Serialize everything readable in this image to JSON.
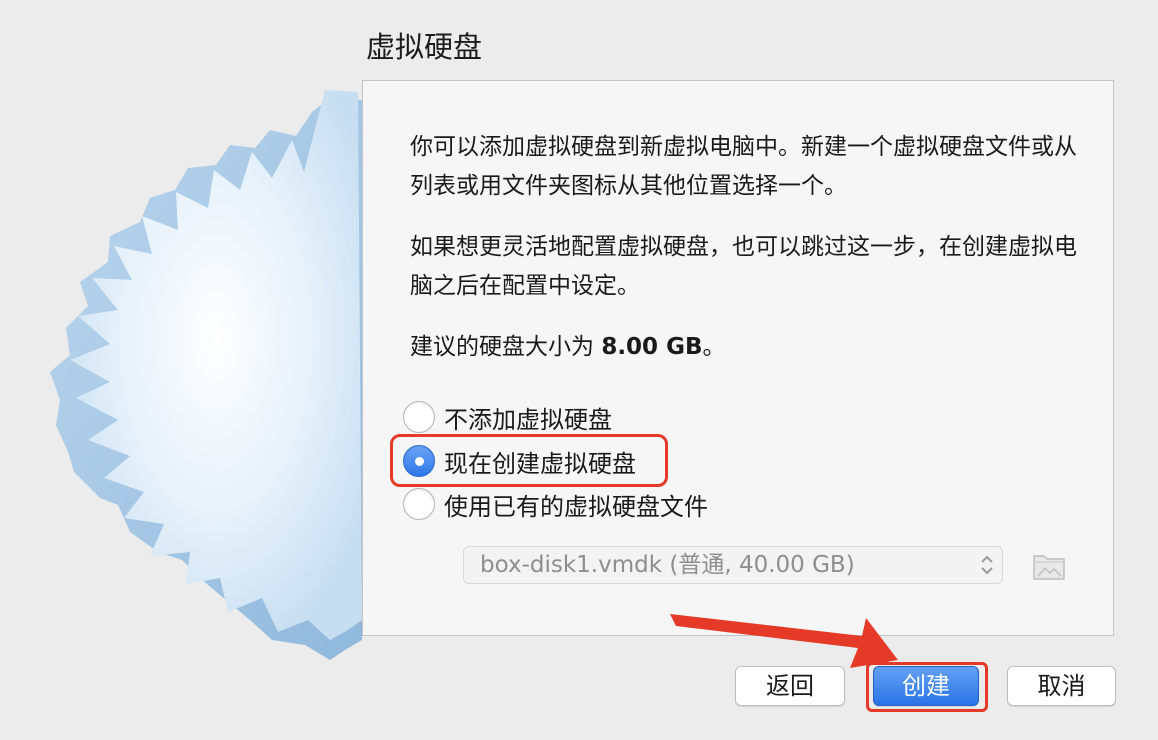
{
  "dialog": {
    "title": "虚拟硬盘"
  },
  "description": {
    "paragraph1": "你可以添加虚拟硬盘到新虚拟电脑中。新建一个虚拟硬盘文件或从列表或用文件夹图标从其他位置选择一个。",
    "paragraph2": "如果想更灵活地配置虚拟硬盘，也可以跳过这一步，在创建虚拟电脑之后在配置中设定。",
    "recommend_prefix": "建议的硬盘大小为 ",
    "recommend_size": "8.00 GB",
    "recommend_suffix": "。"
  },
  "options": {
    "no_disk": {
      "label": "不添加虚拟硬盘",
      "checked": false
    },
    "create_now": {
      "label": "现在创建虚拟硬盘",
      "checked": true
    },
    "use_existing": {
      "label": "使用已有的虚拟硬盘文件",
      "checked": false
    }
  },
  "disk_select": {
    "value": "box-disk1.vmdk (普通, 40.00 GB)",
    "enabled": false
  },
  "buttons": {
    "back": "返回",
    "create": "创建",
    "cancel": "取消"
  },
  "colors": {
    "accent": "#2f76e8",
    "annotation": "#e43a27",
    "panel_background": "#f6f6f6",
    "window_background": "#ececec"
  },
  "icons": {
    "folder_button": "folder-icon",
    "select_arrows": "updown-chevron-icon"
  }
}
